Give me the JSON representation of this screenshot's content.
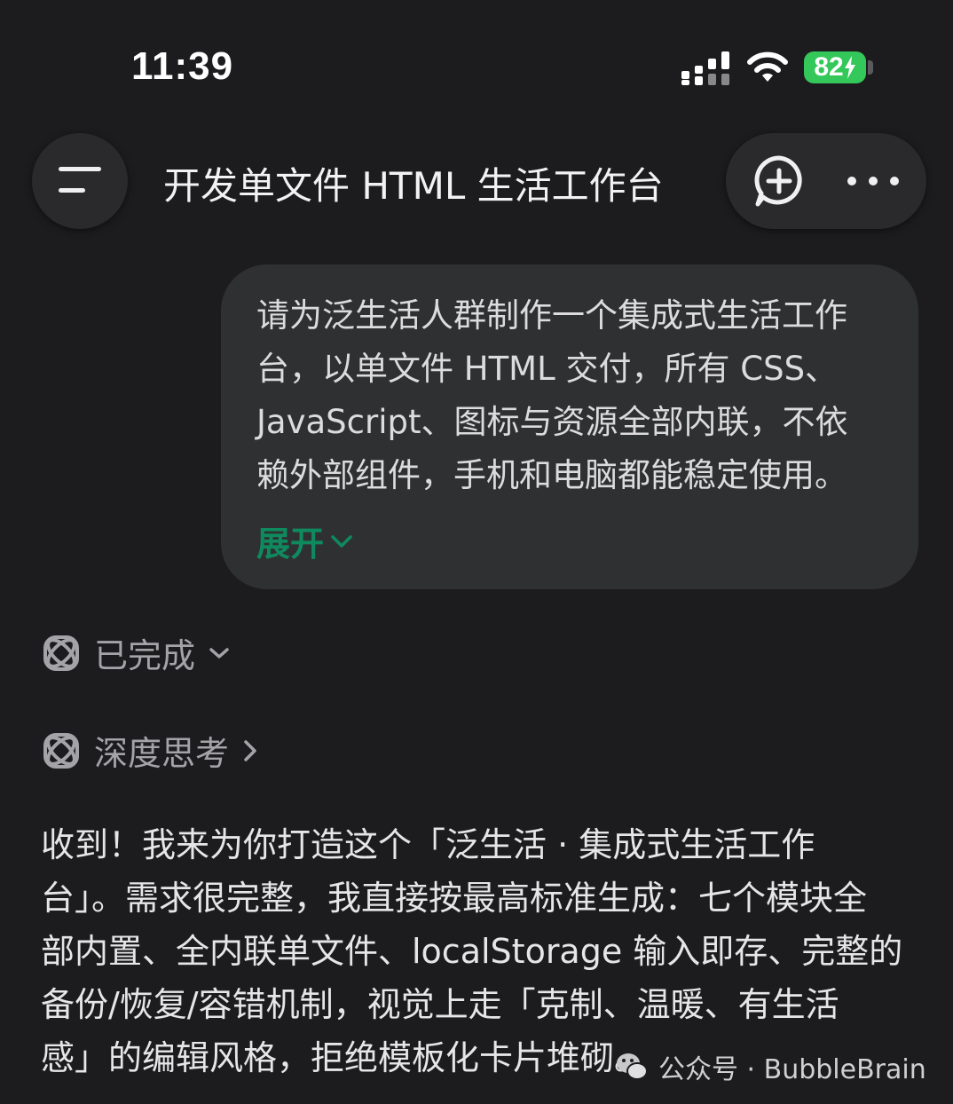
{
  "status_bar": {
    "time": "11:39",
    "battery": "82"
  },
  "header": {
    "title": "开发单文件 HTML 生活工作台"
  },
  "user_message": {
    "lines": [
      "请为泛生活人群制作一个集成式生活工作",
      "台，以单文件 HTML 交付，所有 CSS、",
      "JavaScript、图标与资源全部内联，不依",
      "赖外部组件，手机和电脑都能稳定使用。"
    ],
    "expand_label": "展开"
  },
  "assistant": {
    "status_label": "已完成",
    "thinking_label": "深度思考",
    "reply_lines": [
      "收到！我来为你打造这个「泛生活 · 集成式生活工作",
      "台」。需求很完整，我直接按最高标准生成：七个模块全",
      "部内置、全内联单文件、localStorage 输入即存、完整的",
      "备份/恢复/容错机制，视觉上走「克制、温暖、有生活",
      "感」的编辑风格，拒绝模板化卡片堆砌。"
    ]
  },
  "watermark": {
    "text": "公众号 · BubbleBrain"
  },
  "colors": {
    "background": "#1c1c1e",
    "bubble": "#2f3032",
    "accent_green": "#0f8a5f",
    "battery_green": "#34c759"
  }
}
